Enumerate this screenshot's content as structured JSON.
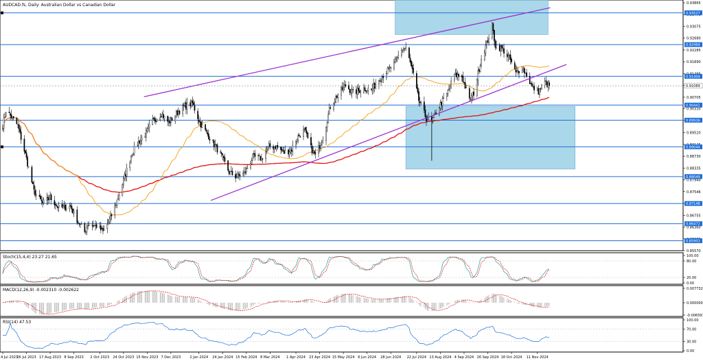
{
  "symbol_title": "AUDCAD.fs, Daily: Australian Dollar vs Canadian Dollar",
  "colors": {
    "price": "#000000",
    "ma_fast": "#f5a623",
    "ma_slow": "#e01010",
    "channel": "#9b30d0",
    "hline": "#1e6fd9",
    "zone": "#8ec9e2",
    "stoch_main": "#2a9d8f",
    "stoch_signal": "#e01010",
    "macd_hist": "#a9a9a9",
    "macd_signal": "#e01010",
    "rsi": "#1e6fd9"
  },
  "price_axis": {
    "labels": [
      "0.93865",
      "0.93470",
      "0.93075",
      "0.92680",
      "0.92285",
      "0.91890",
      "0.91495",
      "0.91100",
      "0.90705",
      "0.90330",
      "0.89935",
      "0.89520",
      "0.89125",
      "0.88730",
      "0.88335",
      "0.87940",
      "0.87546",
      "0.87150",
      "0.86755",
      "0.86360",
      "0.85965",
      "0.85570"
    ],
    "highlighted": [
      "0.93527",
      "0.92464",
      "0.91404",
      "0.91089",
      "0.90441",
      "0.89936",
      "0.89044",
      "0.88049",
      "0.87148",
      "0.86472",
      "0.85903"
    ],
    "current_price": "0.91089"
  },
  "date_axis": [
    "4 Jul 2023",
    "26 Jul 2023",
    "17 Aug 2023",
    "8 Sep 2023",
    "2 Oct 2023",
    "24 Oct 2023",
    "15 Nov 2023",
    "7 Dec 2023",
    "2 Jan 2024",
    "24 Jan 2024",
    "15 Feb 2024",
    "8 Mar 2024",
    "1 Apr 2024",
    "23 Apr 2024",
    "15 May 2024",
    "6 Jun 2024",
    "28 Jun 2024",
    "22 Jul 2024",
    "13 Aug 2024",
    "4 Sep 2024",
    "26 Sep 2024",
    "18 Oct 2024",
    "11 Nov 2024"
  ],
  "stoch": {
    "title": "Stoch(15,4,4) 23.27 21.65",
    "axis": [
      "100.00",
      "80.00",
      "20.00",
      "0.00"
    ]
  },
  "macd": {
    "title": "MACD(12,26,9) -0.002310 -0.002622",
    "axis": [
      "0.007732",
      "0.000000",
      "-0.006597"
    ]
  },
  "rsi": {
    "title": "RSI(14) 47.53",
    "axis": [
      "100.00",
      "70.00",
      "30.00",
      "0.00"
    ]
  },
  "chart_data": {
    "type": "candlestick",
    "title": "AUDCAD.fs, Daily: Australian Dollar vs Canadian Dollar",
    "ylim": [
      0.8557,
      0.93865
    ],
    "waypoints": [
      [
        "2023-07-04",
        0.8975
      ],
      [
        "2023-07-07",
        0.9025
      ],
      [
        "2023-07-12",
        0.9005
      ],
      [
        "2023-07-18",
        0.8975
      ],
      [
        "2023-07-26",
        0.8865
      ],
      [
        "2023-08-02",
        0.8755
      ],
      [
        "2023-08-10",
        0.8715
      ],
      [
        "2023-08-17",
        0.8735
      ],
      [
        "2023-08-25",
        0.87
      ],
      [
        "2023-09-05",
        0.8705
      ],
      [
        "2023-09-11",
        0.866
      ],
      [
        "2023-09-18",
        0.862
      ],
      [
        "2023-09-21",
        0.8645
      ],
      [
        "2023-09-29",
        0.864
      ],
      [
        "2023-10-05",
        0.862
      ],
      [
        "2023-10-12",
        0.8665
      ],
      [
        "2023-10-20",
        0.8745
      ],
      [
        "2023-10-26",
        0.8815
      ],
      [
        "2023-11-01",
        0.8885
      ],
      [
        "2023-11-07",
        0.892
      ],
      [
        "2023-11-14",
        0.895
      ],
      [
        "2023-11-20",
        0.899
      ],
      [
        "2023-11-28",
        0.9015
      ],
      [
        "2023-12-05",
        0.8985
      ],
      [
        "2023-12-13",
        0.902
      ],
      [
        "2023-12-20",
        0.904
      ],
      [
        "2023-12-27",
        0.905
      ],
      [
        "2024-01-03",
        0.8985
      ],
      [
        "2024-01-12",
        0.8935
      ],
      [
        "2024-01-22",
        0.888
      ],
      [
        "2024-01-30",
        0.882
      ],
      [
        "2024-02-05",
        0.8805
      ],
      [
        "2024-02-13",
        0.8815
      ],
      [
        "2024-02-21",
        0.887
      ],
      [
        "2024-02-29",
        0.8865
      ],
      [
        "2024-03-07",
        0.8905
      ],
      [
        "2024-03-14",
        0.8905
      ],
      [
        "2024-03-21",
        0.8885
      ],
      [
        "2024-03-28",
        0.8895
      ],
      [
        "2024-04-02",
        0.8935
      ],
      [
        "2024-04-09",
        0.896
      ],
      [
        "2024-04-15",
        0.89
      ],
      [
        "2024-04-19",
        0.8875
      ],
      [
        "2024-04-26",
        0.8935
      ],
      [
        "2024-05-03",
        0.904
      ],
      [
        "2024-05-10",
        0.908
      ],
      [
        "2024-05-17",
        0.911
      ],
      [
        "2024-05-24",
        0.9085
      ],
      [
        "2024-06-03",
        0.91
      ],
      [
        "2024-06-10",
        0.9095
      ],
      [
        "2024-06-17",
        0.913
      ],
      [
        "2024-06-24",
        0.9155
      ],
      [
        "2024-07-01",
        0.918
      ],
      [
        "2024-07-08",
        0.923
      ],
      [
        "2024-07-12",
        0.9235
      ],
      [
        "2024-07-18",
        0.916
      ],
      [
        "2024-07-24",
        0.906
      ],
      [
        "2024-07-31",
        0.9
      ],
      [
        "2024-08-05",
        0.899
      ],
      [
        "2024-08-12",
        0.904
      ],
      [
        "2024-08-19",
        0.908
      ],
      [
        "2024-08-26",
        0.9145
      ],
      [
        "2024-09-02",
        0.914
      ],
      [
        "2024-09-09",
        0.906
      ],
      [
        "2024-09-13",
        0.9085
      ],
      [
        "2024-09-20",
        0.92
      ],
      [
        "2024-09-26",
        0.926
      ],
      [
        "2024-09-30",
        0.931
      ],
      [
        "2024-10-03",
        0.9245
      ],
      [
        "2024-10-10",
        0.923
      ],
      [
        "2024-10-17",
        0.9195
      ],
      [
        "2024-10-22",
        0.915
      ],
      [
        "2024-10-28",
        0.917
      ],
      [
        "2024-11-01",
        0.9145
      ],
      [
        "2024-11-06",
        0.9105
      ],
      [
        "2024-11-12",
        0.909
      ],
      [
        "2024-11-18",
        0.912
      ],
      [
        "2024-11-22",
        0.9109
      ]
    ],
    "series": [
      {
        "name": "AUDCAD.fs"
      }
    ],
    "trendlines": [
      {
        "from": [
          "2023-11-12",
          0.9072
        ],
        "to": [
          "2024-11-23",
          0.937
        ]
      },
      {
        "from": [
          "2024-01-13",
          0.8725
        ],
        "to": [
          "2024-12-08",
          0.918
        ]
      }
    ],
    "horizontal_levels": [
      0.93527,
      0.92464,
      0.91404,
      0.90441,
      0.89936,
      0.89044,
      0.88049,
      0.87148,
      0.86472,
      0.85903
    ],
    "zones": [
      {
        "x": [
          "2024-07-02",
          "2024-11-21"
        ],
        "y": [
          0.928,
          0.9398
        ]
      },
      {
        "x": [
          "2024-07-12",
          "2024-12-16"
        ],
        "y": [
          0.883,
          0.904
        ]
      }
    ],
    "indicators": [
      "Stoch(15,4,4)",
      "MACD(12,26,9)",
      "RSI(14)"
    ]
  }
}
